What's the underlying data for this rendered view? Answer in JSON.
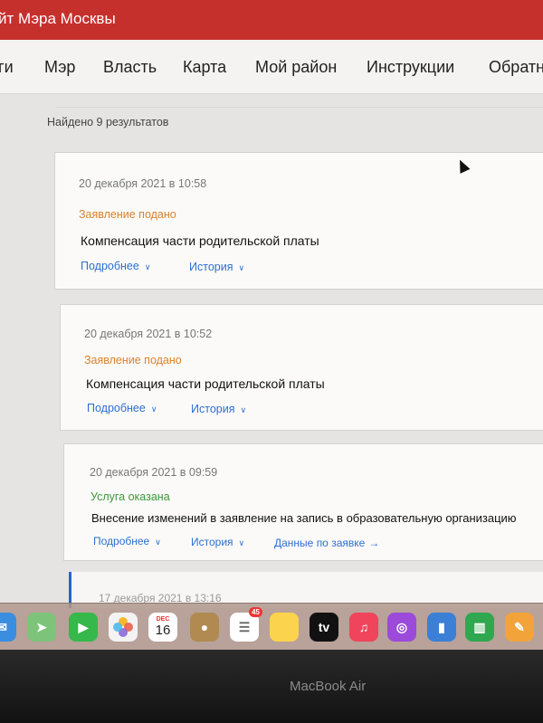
{
  "header": {
    "title": "йт Мэра Москвы"
  },
  "nav": [
    {
      "label": "ги"
    },
    {
      "label": "Мэр"
    },
    {
      "label": "Власть"
    },
    {
      "label": "Карта"
    },
    {
      "label": "Мой район"
    },
    {
      "label": "Инструкции"
    },
    {
      "label": "Обратн"
    }
  ],
  "results": {
    "count_text": "Найдено 9 результатов",
    "items": [
      {
        "date": "20 декабря 2021 в 10:58",
        "status": "Заявление подано",
        "title": "Компенсация части родительской платы",
        "details_label": "Подробнее",
        "history_label": "История"
      },
      {
        "date": "20 декабря 2021 в 10:52",
        "status": "Заявление подано",
        "title": "Компенсация части родительской платы",
        "details_label": "Подробнее",
        "history_label": "История"
      },
      {
        "date": "20 декабря 2021 в 09:59",
        "status": "Услуга оказана",
        "title": "Внесение изменений в заявление на запись в образовательную организацию",
        "details_label": "Подробнее",
        "history_label": "История",
        "extra_label": "Данные по заявке"
      }
    ],
    "partial_date": "17 декабря 2021 в 13:16"
  },
  "colors": {
    "brand_red": "#c6302c",
    "status_submitted": "#d9822b",
    "status_done": "#3a9a3a",
    "link_blue": "#2d6fd1"
  },
  "dock": {
    "calendar_month": "DEC",
    "calendar_day": "16",
    "reminders_badge": "45",
    "tv_label": "tv",
    "icons": [
      "mail-icon",
      "maps-icon",
      "facetime-icon",
      "photos-icon",
      "calendar-icon",
      "finder-icon",
      "reminders-icon",
      "notes-icon",
      "apple-tv-icon",
      "music-icon",
      "podcasts-icon",
      "keynote-icon",
      "numbers-icon",
      "pages-icon"
    ]
  },
  "bezel": {
    "brand": "MacBook Air"
  }
}
